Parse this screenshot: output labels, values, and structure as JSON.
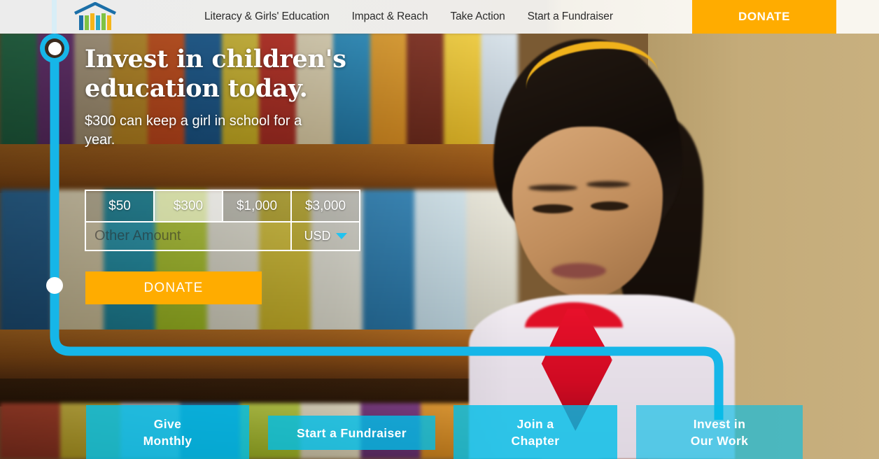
{
  "nav": {
    "logo_name": "library-bookshelf-logo",
    "links": [
      {
        "label": "Literacy & Girls' Education"
      },
      {
        "label": "Impact & Reach"
      },
      {
        "label": "Take Action"
      },
      {
        "label": "Start a Fundraiser"
      }
    ],
    "donate_label": "DONATE",
    "donate_color": "#ffac00"
  },
  "hero": {
    "title_line1": "Invest in children's",
    "title_line2": "education today.",
    "subtitle": "$300 can keep a girl in school for a year."
  },
  "donation_form": {
    "amounts": [
      {
        "label": "$50",
        "selected": false
      },
      {
        "label": "$300",
        "selected": true
      },
      {
        "label": "$1,000",
        "selected": false
      },
      {
        "label": "$3,000",
        "selected": false
      }
    ],
    "other_amount_placeholder": "Other Amount",
    "other_amount_value": "",
    "currency": "USD",
    "currency_chevron": "chevron-down-icon",
    "submit_label": "DONATE"
  },
  "path": {
    "color": "#16b6e8",
    "top_node": "timeline-node-start",
    "mid_node": "timeline-node-mid"
  },
  "cta_tiles": [
    {
      "line1": "Give",
      "line2": "Monthly",
      "name": "give-monthly"
    },
    {
      "line1": "Start a Fundraiser",
      "line2": "",
      "name": "start-a-fundraiser"
    },
    {
      "line1": "Join a",
      "line2": "Chapter",
      "name": "join-a-chapter"
    },
    {
      "line1": "Invest in",
      "line2": "Our Work",
      "name": "invest-in-our-work"
    }
  ],
  "colors": {
    "accent_cyan": "#00bee8",
    "accent_orange": "#ffac00",
    "nav_bg": "#efeeea"
  }
}
